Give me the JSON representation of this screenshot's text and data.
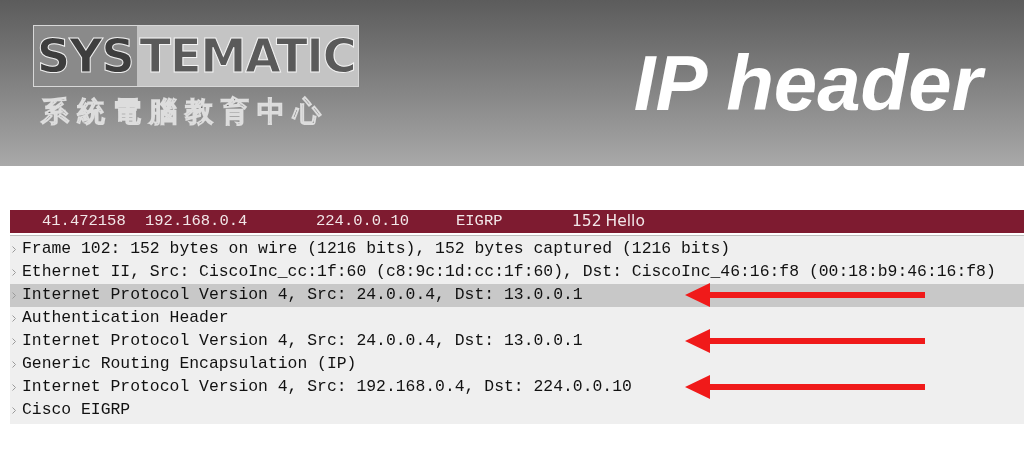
{
  "logo": {
    "wordmark_dark": "SYS",
    "wordmark_light": "TEMATIC",
    "subtitle": "系統電腦教育中心"
  },
  "title": "IP header",
  "packet": {
    "time": "41.472158",
    "source": "192.168.0.4",
    "destination": "224.0.0.10",
    "protocol": "EIGRP",
    "length": "152",
    "info": "Hello"
  },
  "details": [
    {
      "text": "Frame 102: 152 bytes on wire (1216 bits), 152 bytes captured (1216 bits)",
      "selected": false,
      "arrow": false
    },
    {
      "text": "Ethernet II, Src: CiscoInc_cc:1f:60 (c8:9c:1d:cc:1f:60), Dst: CiscoInc_46:16:f8 (00:18:b9:46:16:f8)",
      "selected": false,
      "arrow": false
    },
    {
      "text": "Internet Protocol Version 4, Src: 24.0.0.4, Dst: 13.0.0.1",
      "selected": true,
      "arrow": true
    },
    {
      "text": "Authentication Header",
      "selected": false,
      "arrow": false
    },
    {
      "text": "Internet Protocol Version 4, Src: 24.0.0.4, Dst: 13.0.0.1",
      "selected": false,
      "arrow": true
    },
    {
      "text": "Generic Routing Encapsulation (IP)",
      "selected": false,
      "arrow": false
    },
    {
      "text": "Internet Protocol Version 4, Src: 192.168.0.4, Dst: 224.0.0.10",
      "selected": false,
      "arrow": true
    },
    {
      "text": "Cisco EIGRP",
      "selected": false,
      "arrow": false
    }
  ]
}
